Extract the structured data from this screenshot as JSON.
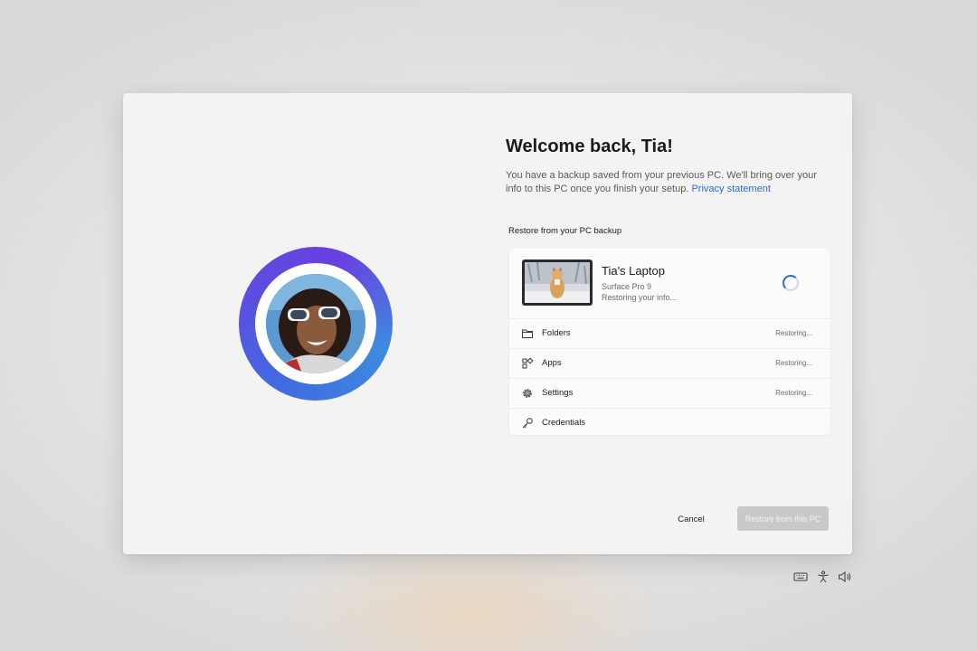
{
  "dialog": {
    "title": "Welcome back, Tia!",
    "description": "You have a backup saved from your previous PC. We'll bring over your info to this PC once you finish your setup.",
    "privacy_link": "Privacy statement",
    "section_label": "Restore from your PC backup"
  },
  "device": {
    "name": "Tia's Laptop",
    "model": "Surface Pro 9",
    "status": "Restoring your info..."
  },
  "items": [
    {
      "label": "Folders",
      "status": "Restoring..."
    },
    {
      "label": "Apps",
      "status": "Restoring..."
    },
    {
      "label": "Settings",
      "status": "Restoring..."
    },
    {
      "label": "Credentials",
      "status": ""
    }
  ],
  "buttons": {
    "cancel": "Cancel",
    "restore": "Restore from this PC"
  },
  "icons": {
    "folders": "folder-icon",
    "apps": "apps-icon",
    "settings": "gear-icon",
    "credentials": "key-icon",
    "tray": [
      "keyboard-icon",
      "accessibility-icon",
      "volume-icon"
    ]
  },
  "colors": {
    "accent": "#2f6ad0",
    "ring_gradient": [
      "#3f6ee0",
      "#6a3fe0"
    ],
    "disabled_button": "#c9c9c9"
  }
}
